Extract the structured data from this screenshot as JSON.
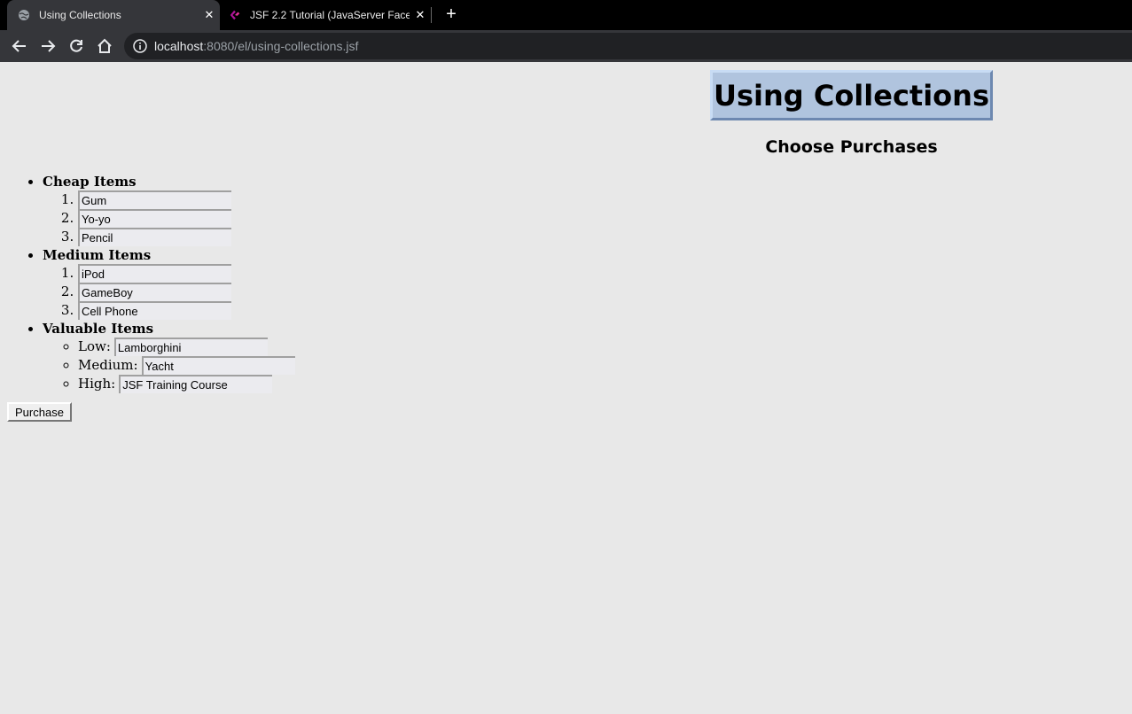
{
  "browser": {
    "tabs": [
      {
        "title": "Using Collections",
        "favicon": "globe-icon",
        "active": true
      },
      {
        "title": "JSF 2.2 Tutorial (JavaServer Faces",
        "favicon": "coreservlets-icon",
        "active": false
      }
    ],
    "url": {
      "host": "localhost",
      "path": ":8080/el/using-collections.jsf"
    }
  },
  "page": {
    "title": "Using Collections",
    "subtitle": "Choose Purchases",
    "categories": {
      "cheap": {
        "label": "Cheap Items",
        "items": [
          "1.",
          "2.",
          "3."
        ],
        "values": [
          "Gum",
          "Yo-yo",
          "Pencil"
        ]
      },
      "medium": {
        "label": "Medium Items",
        "items": [
          "1.",
          "2.",
          "3."
        ],
        "values": [
          "iPod",
          "GameBoy",
          "Cell Phone"
        ]
      },
      "valuable": {
        "label": "Valuable Items",
        "low_label": "Low:",
        "low_value": "Lamborghini",
        "medium_label": "Medium:",
        "medium_value": "Yacht",
        "high_label": "High:",
        "high_value": "JSF Training Course"
      }
    },
    "purchase_label": "Purchase"
  }
}
